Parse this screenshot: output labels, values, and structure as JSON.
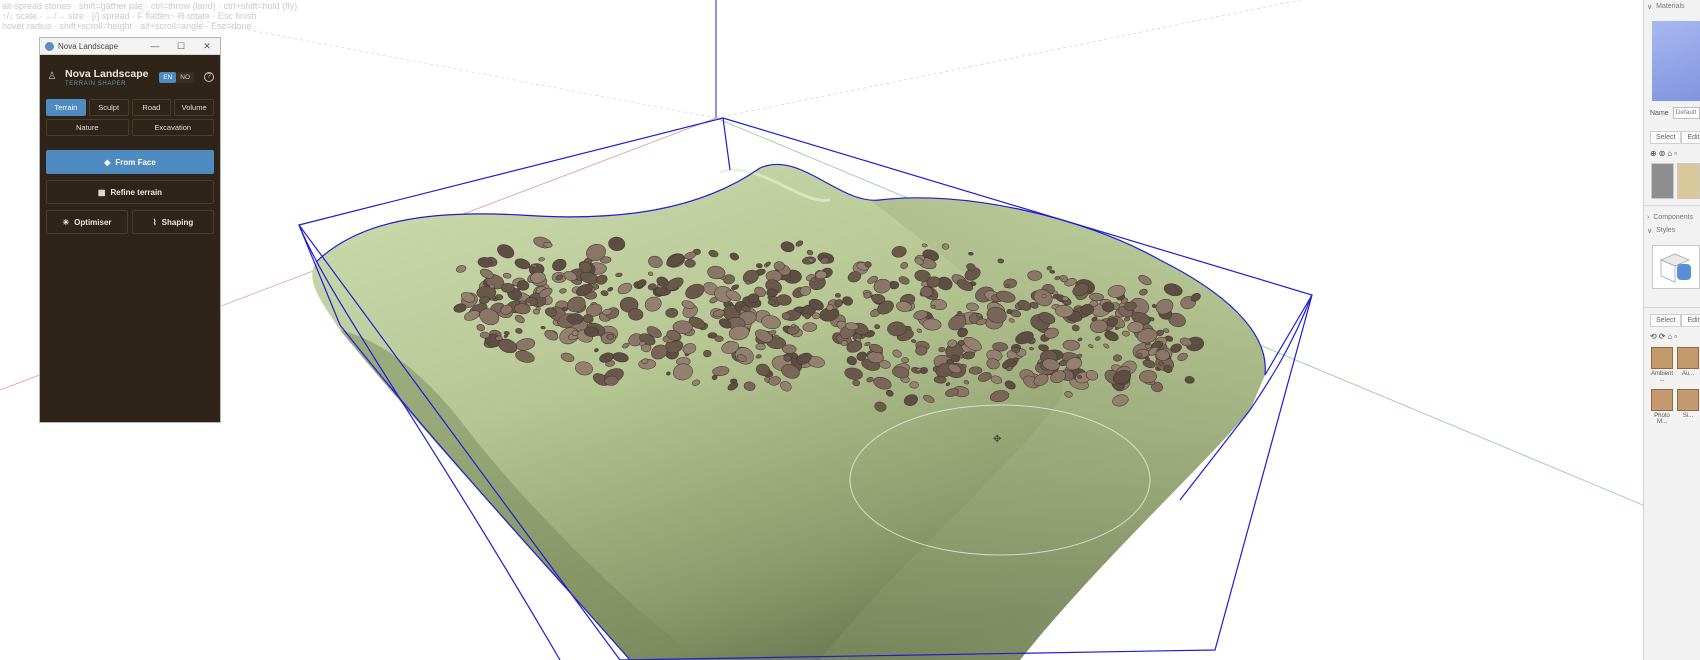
{
  "viewport": {
    "hint_lines": [
      "alt-spread stones · shift=gather pile · ctrl=throw (land) · ctrl+shift=hold (fly)",
      "↑/↓ scale · ←/→ size · [/] spread · F flatten · R rotate · Esc finish",
      "hover radius · shift+scroll=height · alt+scroll=angle · Esc=done"
    ],
    "accent_colors": {
      "sky_axis": "#2b2bd0",
      "bbox": "#1d1dd6",
      "terrain_light": "#c8d8a8",
      "terrain_dark": "#6f7d55",
      "rock": "#7a6658"
    }
  },
  "plugin": {
    "window_title": "Nova Landscape",
    "window_buttons": [
      "—",
      "☐",
      "✕"
    ],
    "name": "Nova Landscape",
    "subtitle": "TERRAIN SHAPER",
    "lang": {
      "options": [
        "EN",
        "NO"
      ],
      "active": "EN"
    },
    "help_icon": "?",
    "tabs": [
      "Terrain",
      "Sculpt",
      "Road",
      "Volume"
    ],
    "tabs_row2": [
      "Nature",
      "Excavation"
    ],
    "active_tab": "Terrain",
    "primary_button": "From Face",
    "refine_button": "Refine terrain",
    "optimiser_button": "Optimiser",
    "shaping_button": "Shaping",
    "accent_color": "#4f8bc0",
    "panel_color": "#2e2418"
  },
  "tray": {
    "materials_header": "Materials",
    "name_label": "Name",
    "name_value": "Default",
    "select_tab": "Select",
    "edit_tab": "Edit",
    "components_header": "Components",
    "styles_header": "Styles",
    "styles_select_tab": "Select",
    "styles_edit_tab": "Edit",
    "items": [
      "Ambient ...",
      "Au...",
      "Photo M...",
      "Si..."
    ]
  }
}
